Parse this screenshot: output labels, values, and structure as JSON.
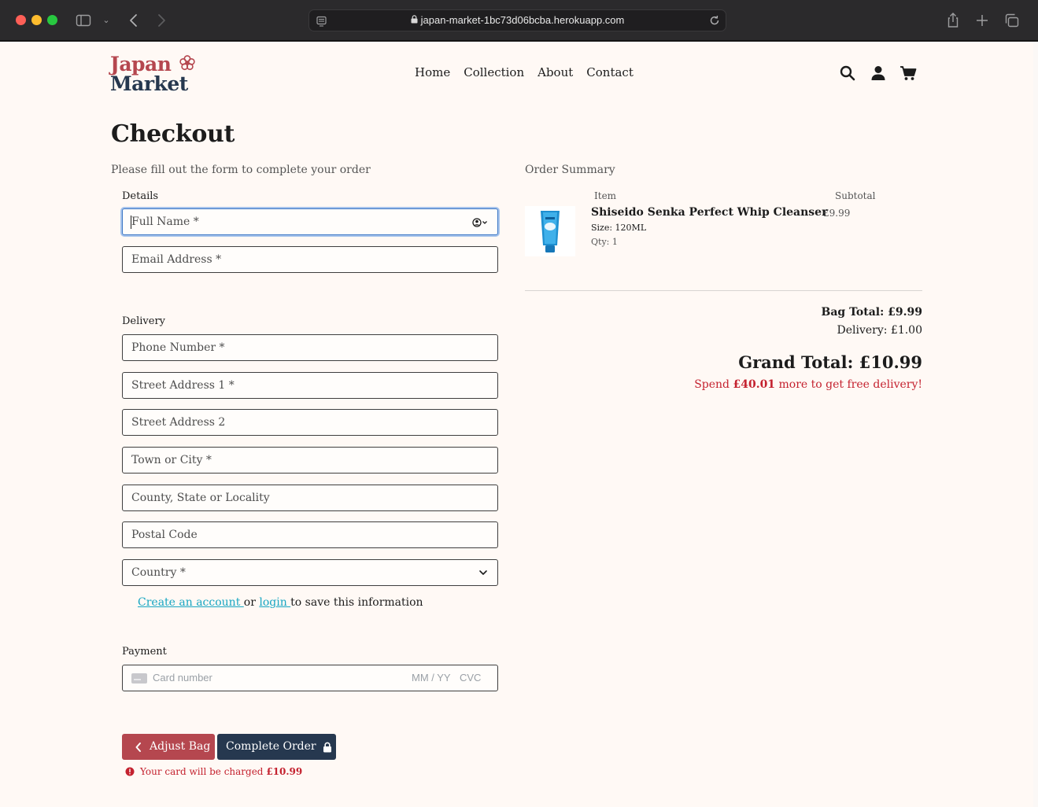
{
  "browser": {
    "url": "japan-market-1bc73d06bcba.herokuapp.com"
  },
  "header": {
    "logo_line1": "Japan",
    "logo_line2": "Market",
    "nav": [
      "Home",
      "Collection",
      "About",
      "Contact"
    ],
    "icons": [
      "search-icon",
      "user-icon",
      "cart-icon"
    ]
  },
  "checkout": {
    "title": "Checkout",
    "intro": "Please fill out the form to complete your order",
    "details_legend": "Details",
    "full_name_placeholder": "Full Name *",
    "email_placeholder": "Email Address *",
    "delivery_legend": "Delivery",
    "phone_placeholder": "Phone Number *",
    "street1_placeholder": "Street Address 1 *",
    "street2_placeholder": "Street Address 2",
    "town_placeholder": "Town or City *",
    "county_placeholder": "County, State or Locality",
    "postcode_placeholder": "Postal Code",
    "country_placeholder": "Country *",
    "save_info": {
      "create_account": "Create an account ",
      "or": "or ",
      "login": "login ",
      "rest": "to save this information"
    },
    "payment_legend": "Payment",
    "card": {
      "number_placeholder": "Card number",
      "expiry_placeholder": "MM / YY",
      "cvc_placeholder": "CVC"
    },
    "adjust_bag_label": "Adjust Bag",
    "complete_order_label": "Complete Order",
    "charge_note_prefix": "Your card will be charged ",
    "charge_amount": "£10.99"
  },
  "summary": {
    "title": "Order Summary",
    "col_item": "Item",
    "col_subtotal": "Subtotal",
    "items": [
      {
        "name": "Shiseido Senka Perfect Whip Cleanser",
        "size": "Size: 120ML",
        "qty": "Qty: 1",
        "subtotal": "£9.99"
      }
    ],
    "bag_total": "Bag Total: £9.99",
    "delivery": "Delivery: £1.00",
    "grand_total": "Grand Total: £10.99",
    "free_delivery_prefix": "Spend ",
    "free_delivery_amount": "£40.01",
    "free_delivery_suffix": " more to get free delivery!"
  },
  "colors": {
    "brand_red": "#b5474f",
    "brand_navy": "#26384f",
    "link": "#17a6c2",
    "alert_red": "#c4222f",
    "page_bg": "#fff9f5"
  }
}
